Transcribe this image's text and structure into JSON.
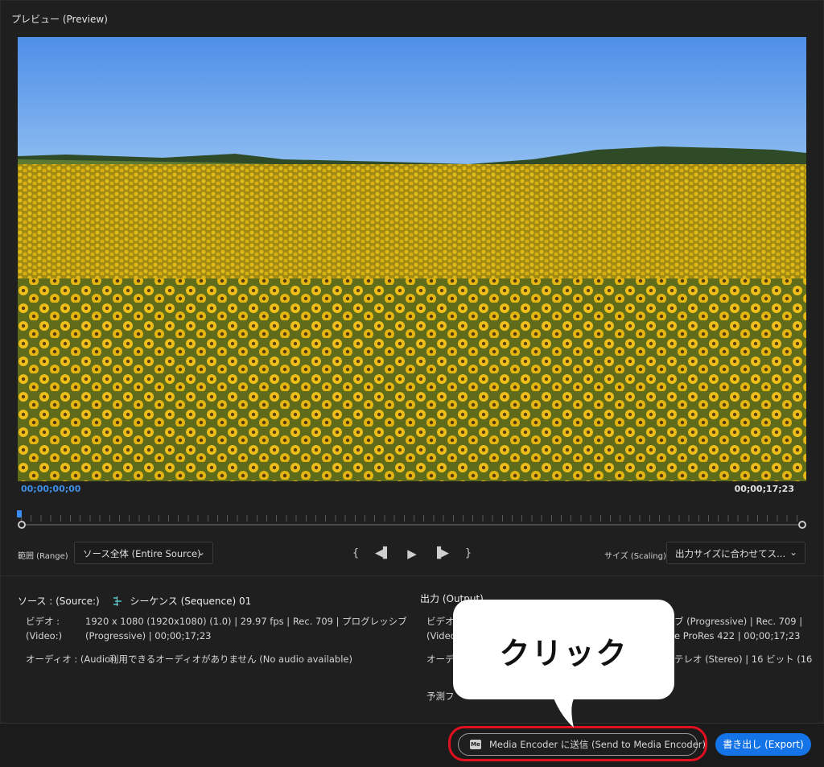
{
  "window": {
    "title": "プレビュー (Preview)"
  },
  "timecode": {
    "start": "00;00;00;00",
    "end": "00;00;17;23"
  },
  "range": {
    "label": "範囲 (Range)",
    "value": "ソース全体 (Entire Source)"
  },
  "scaling": {
    "label": "サイズ (Scaling)",
    "value": "出力サイズに合わせてス..."
  },
  "source": {
    "heading": "ソース : (Source:)",
    "sequence_name": "シーケンス (Sequence) 01",
    "video_label": "ビデオ :",
    "video_label_en": "(Video:)",
    "video_line1": "1920 x 1080 (1920x1080) (1.0) | 29.97 fps | Rec. 709 | プログレッシブ",
    "video_line2": "(Progressive) | 00;00;17;23",
    "audio_label": "オーディオ : (Audio:)",
    "audio_value": "利用できるオーディオがありません (No audio available)"
  },
  "output": {
    "heading": "出力 (Output)",
    "video_label": "ビデオ :",
    "video_label_en": "(Video:",
    "video_line1": "ブ (Progressive) | Rec. 709 |",
    "video_line2": "e ProRes 422 | 00;00;17;23",
    "audio_label": "オーディ",
    "audio_value": "テレオ (Stereo) | 16 ビット (16",
    "estimate_label": "予測フ"
  },
  "footer": {
    "send_label": "Media Encoder に送信 (Send to Media Encoder)",
    "me_icon_text": "Me",
    "export_label": "書き出し (Export)"
  },
  "callout": {
    "text": "クリック"
  },
  "colors": {
    "accent": "#1473e6",
    "timecode": "#3d8fe6",
    "highlight": "#e0101e"
  }
}
